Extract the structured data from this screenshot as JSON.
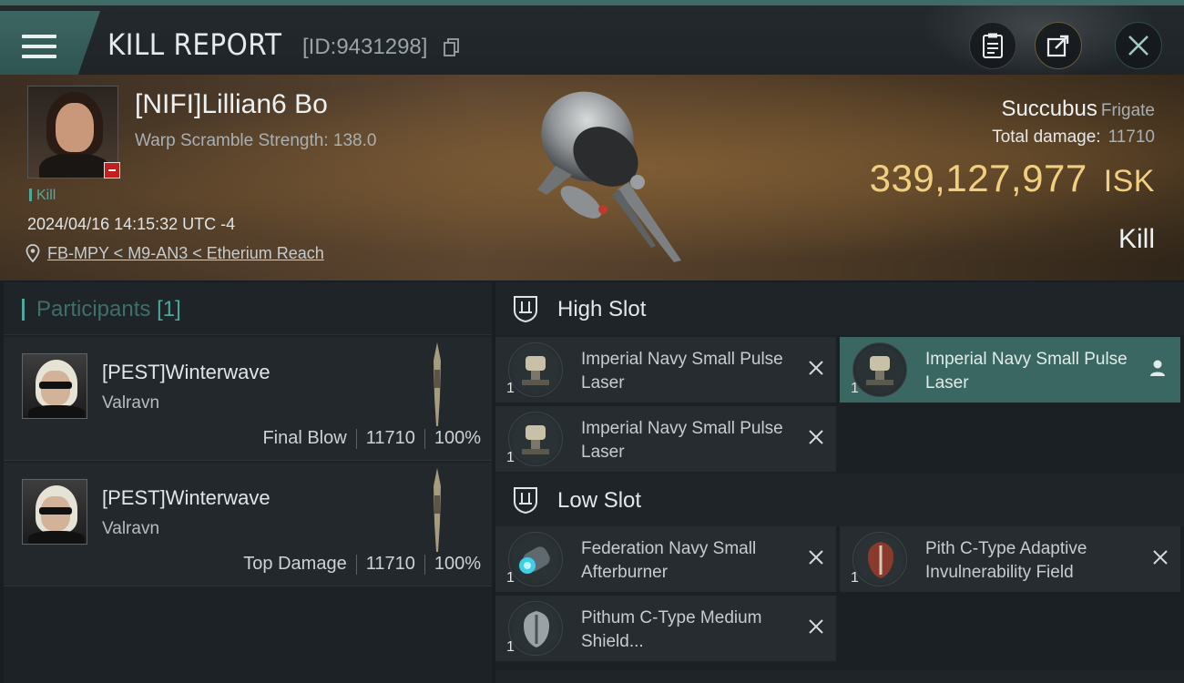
{
  "header": {
    "title": "KILL REPORT",
    "report_id": "[ID:9431298]"
  },
  "victim": {
    "name": "[NIFI]Lillian6 Bo",
    "scramble": "Warp Scramble Strength: 138.0",
    "tag": "Kill",
    "datetime": "2024/04/16 14:15:32 UTC -4",
    "location": "FB-MPY < M9-AN3 < Etherium Reach"
  },
  "ship": {
    "name": "Succubus",
    "class": "Frigate",
    "total_damage_label": "Total damage:",
    "total_damage": "11710",
    "isk_value": "339,127,977",
    "isk_unit": "ISK",
    "result": "Kill"
  },
  "participants": {
    "title": "Participants",
    "count": "[1]",
    "rows": [
      {
        "name": "[PEST]Winterwave",
        "ship": "Valravn",
        "role": "Final Blow",
        "damage": "11710",
        "percent": "100%"
      },
      {
        "name": "[PEST]Winterwave",
        "ship": "Valravn",
        "role": "Top Damage",
        "damage": "11710",
        "percent": "100%"
      }
    ]
  },
  "slots": {
    "high": {
      "title": "High Slot",
      "modules": [
        {
          "name": "Imperial Navy Small Pulse Laser",
          "qty": "1"
        },
        {
          "name": "Imperial Navy Small Pulse Laser",
          "qty": "1"
        },
        {
          "name": "Imperial Navy Small Pulse Laser",
          "qty": "1"
        }
      ]
    },
    "low": {
      "title": "Low Slot",
      "modules": [
        {
          "name": "Federation Navy Small Afterburner",
          "qty": "1"
        },
        {
          "name": "Pith C-Type Adaptive Invulnerability Field",
          "qty": "1"
        },
        {
          "name": "Pithum C-Type Medium Shield...",
          "qty": "1"
        }
      ]
    }
  },
  "colors": {
    "accent": "#3b6763",
    "isk": "#f0cf80",
    "kill_badge": "#c3201d"
  }
}
